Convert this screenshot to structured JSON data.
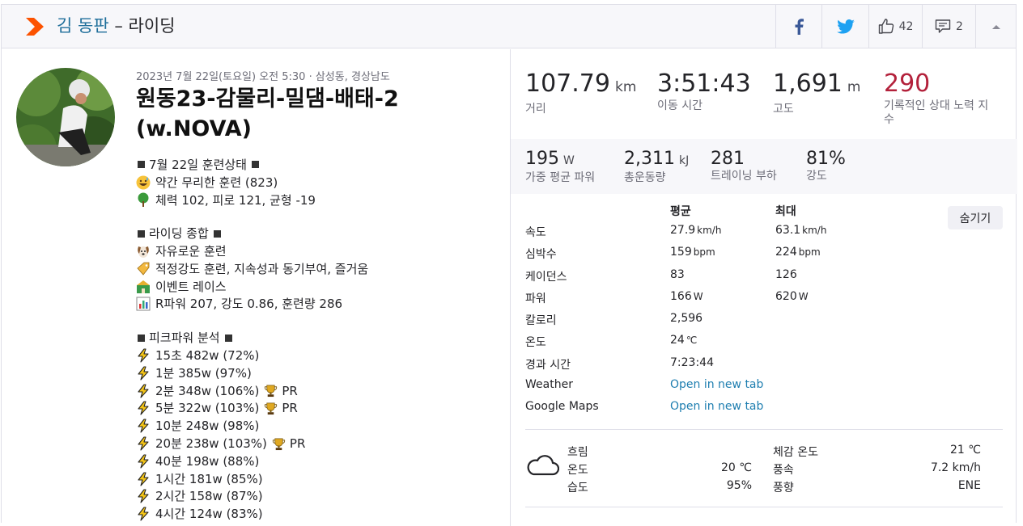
{
  "header": {
    "athlete": "김 동판",
    "separator": " – ",
    "activity_type": "라이딩",
    "kudos_count": "42",
    "comment_count": "2",
    "icons": [
      "strava-logo-icon",
      "facebook-icon",
      "twitter-icon",
      "thumbs-up-icon",
      "comment-icon",
      "chevron-up-icon"
    ]
  },
  "activity": {
    "meta": "2023년 7월 22일(토요일) 오전 5:30 · 삼성동, 경상남도",
    "name": "원동23-감물리-밀댐-배태-2 (w.NOVA)",
    "description": {
      "s1_title": "7월 22일 훈련상태",
      "s1_a": "약간 무리한 훈련 (823)",
      "s1_b": "체력 102, 피로 121, 균형 -19",
      "s2_title": "라이딩 종합",
      "s2_a": "자유로운 훈련",
      "s2_b": "적정강도 훈련, 지속성과 동기부여, 즐거움",
      "s2_c": "이벤트 레이스",
      "s2_d": "R파워 207, 강도 0.86, 훈련량 286",
      "s3_title": "피크파워 분석",
      "peaks": [
        {
          "text": "15초 482w (72%)",
          "pr": ""
        },
        {
          "text": "1분 385w (97%)",
          "pr": ""
        },
        {
          "text": "2분 348w (106%)",
          "pr": "PR"
        },
        {
          "text": "5분 322w (103%)",
          "pr": "PR"
        },
        {
          "text": "10분 248w (98%)",
          "pr": ""
        },
        {
          "text": "20분 238w (103%)",
          "pr": "PR"
        },
        {
          "text": "40분 198w (88%)",
          "pr": ""
        },
        {
          "text": "1시간 181w (85%)",
          "pr": ""
        },
        {
          "text": "2시간 158w (87%)",
          "pr": ""
        },
        {
          "text": "4시간 124w (83%)",
          "pr": ""
        }
      ]
    }
  },
  "stats": {
    "distance": {
      "value": "107.79",
      "unit": "km",
      "label": "거리"
    },
    "moving_time": {
      "value": "3:51:43",
      "label": "이동 시간"
    },
    "elevation": {
      "value": "1,691",
      "unit": "m",
      "label": "고도"
    },
    "relative_effort": {
      "value": "290",
      "label": "기록적인 상대 노력 지수",
      "color": "#b3213b"
    },
    "avg_power": {
      "value": "195",
      "unit": "W",
      "label": "가중 평균 파워"
    },
    "energy": {
      "value": "2,311",
      "unit": "kJ",
      "label": "총운동량"
    },
    "training_load": {
      "value": "281",
      "label": "트레이닝 부하"
    },
    "intensity": {
      "value": "81%",
      "label": "강도"
    }
  },
  "details": {
    "col_avg": "평균",
    "col_max": "최대",
    "hide_label": "숨기기",
    "rows": [
      {
        "label": "속도",
        "avg": "27.9",
        "avg_unit": "km/h",
        "max": "63.1",
        "max_unit": "km/h"
      },
      {
        "label": "심박수",
        "avg": "159",
        "avg_unit": "bpm",
        "max": "224",
        "max_unit": "bpm"
      },
      {
        "label": "케이던스",
        "avg": "83",
        "avg_unit": "",
        "max": "126",
        "max_unit": ""
      },
      {
        "label": "파워",
        "avg": "166",
        "avg_unit": "W",
        "max": "620",
        "max_unit": "W"
      },
      {
        "label": "칼로리",
        "avg": "2,596",
        "avg_unit": "",
        "max": "",
        "max_unit": ""
      },
      {
        "label": "온도",
        "avg": "24",
        "avg_unit": "℃",
        "max": "",
        "max_unit": ""
      },
      {
        "label": "경과 시간",
        "avg": "7:23:44",
        "avg_unit": "",
        "max": "",
        "max_unit": ""
      }
    ],
    "weather_label": "Weather",
    "weather_link": "Open in new tab",
    "maps_label": "Google Maps",
    "maps_link": "Open in new tab"
  },
  "weather": {
    "condition": "흐림",
    "temp_label": "온도",
    "temp_value": "20 ℃",
    "humidity_label": "습도",
    "humidity_value": "95%",
    "feels_label": "체감 온도",
    "feels_value": "21 ℃",
    "wind_label": "풍속",
    "wind_value": "7.2 km/h",
    "wind_dir_label": "풍향",
    "wind_dir_value": "ENE"
  },
  "colors": {
    "link": "#1e7eb0",
    "athlete": "#1e6e9a",
    "strava_orange": "#fc5200",
    "facebook": "#3b5998",
    "twitter": "#1da1f2"
  }
}
